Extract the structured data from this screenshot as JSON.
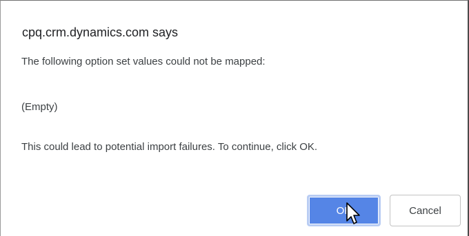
{
  "dialog": {
    "title": "cpq.crm.dynamics.com says",
    "message_line_1": "The following option set values could not be mapped:",
    "message_line_2": "(Empty)",
    "message_line_3": "This could lead to potential import failures. To continue, click OK."
  },
  "buttons": {
    "ok_label": "OK",
    "cancel_label": "Cancel"
  },
  "icons": {
    "cursor": "mouse-pointer-icon"
  },
  "colors": {
    "ok_button": "#5585e6",
    "ok_focus_ring": "#b8ccf3",
    "cancel_border": "#c2c2c2",
    "text": "#3c4043"
  }
}
